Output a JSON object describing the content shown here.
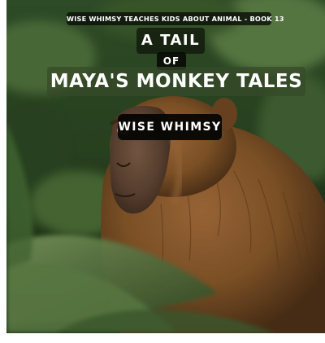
{
  "cover": {
    "series_line": "WISE WHIMSY TEACHES KIDS ABOUT ANIMAL  - BOOK 13",
    "title_line_1": "A TAIL",
    "title_line_2": "OF",
    "title_line_3": "MAYA'S MONKEY TALES",
    "author": "WISE WHIMSY",
    "image_subject": "monkey-in-jungle",
    "colors": {
      "foliage_dark": "#17280f",
      "foliage_mid": "#2d4a22",
      "foliage_light": "#6f8f54",
      "fur": "#8a5a2e",
      "face": "#6b4a35",
      "label_bg": "#0a1008",
      "text": "#ffffff"
    }
  }
}
